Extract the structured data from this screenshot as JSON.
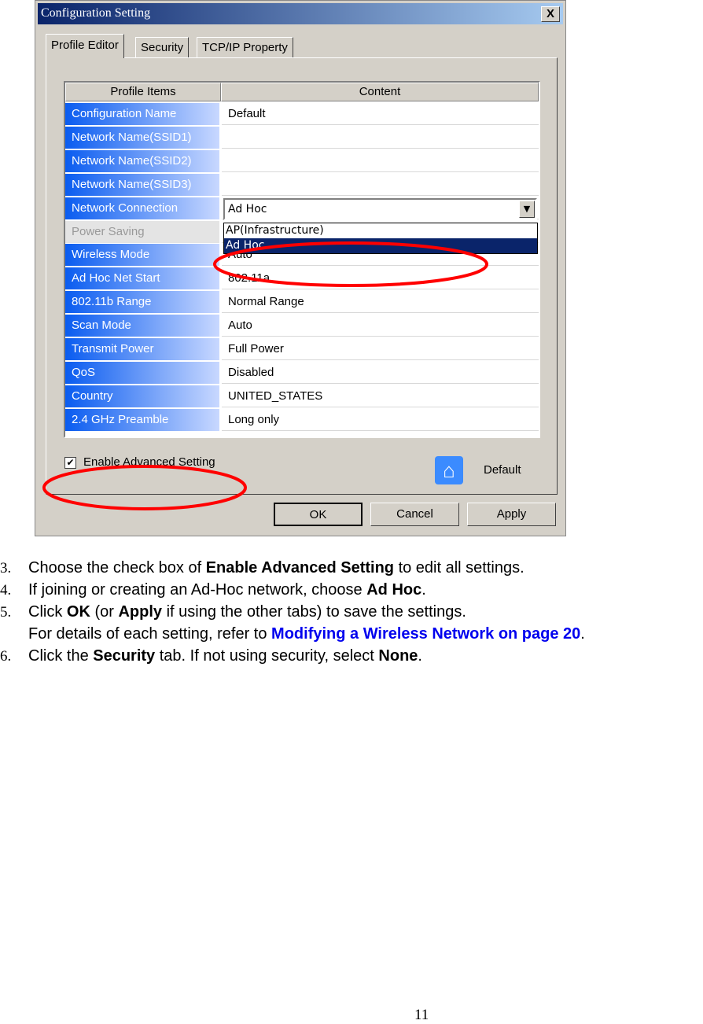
{
  "dialog": {
    "title": "Configuration Setting",
    "close": "X",
    "tabs": [
      "Profile Editor",
      "Security",
      "TCP/IP Property"
    ],
    "headers": [
      "Profile Items",
      "Content"
    ],
    "rows": [
      {
        "label": "Configuration Name",
        "value": "Default"
      },
      {
        "label": "Network Name(SSID1)",
        "value": ""
      },
      {
        "label": "Network Name(SSID2)",
        "value": ""
      },
      {
        "label": "Network Name(SSID3)",
        "value": ""
      },
      {
        "label": "Network Connection",
        "value": ""
      },
      {
        "label": "Power Saving",
        "value": "",
        "disabled": true
      },
      {
        "label": "Wireless Mode",
        "value": "Auto"
      },
      {
        "label": "Ad Hoc Net Start",
        "value": "802.11a"
      },
      {
        "label": "802.11b Range",
        "value": "Normal Range"
      },
      {
        "label": "Scan Mode",
        "value": "Auto"
      },
      {
        "label": "Transmit Power",
        "value": "Full Power"
      },
      {
        "label": "QoS",
        "value": "Disabled"
      },
      {
        "label": "Country",
        "value": "UNITED_STATES"
      },
      {
        "label": "2.4 GHz Preamble",
        "value": "Long only"
      }
    ],
    "connection_select": {
      "value": "Ad Hoc",
      "options": [
        "AP(Infrastructure)",
        "Ad Hoc"
      ],
      "selected": "Ad Hoc"
    },
    "advanced_checkbox": {
      "label": "Enable Advanced Setting",
      "checked": true
    },
    "default_label": "Default",
    "buttons": [
      "OK",
      "Cancel",
      "Apply"
    ],
    "highlight_color": "#ff0000"
  },
  "steps": [
    {
      "num": "3.",
      "parts": [
        "Choose the check box of ",
        "Enable Advanced Setting",
        " to edit all settings."
      ]
    },
    {
      "num": "4.",
      "parts": [
        "If joining or creating an Ad-Hoc network, choose ",
        "Ad Hoc",
        "."
      ]
    },
    {
      "num": "5.",
      "parts": [
        "Click ",
        "OK",
        " (or ",
        "Apply",
        " if using the other tabs) to save the settings."
      ]
    },
    {
      "num": "",
      "parts": [
        "For details of each setting, refer to ",
        "Modifying a Wireless Network on page 20",
        "."
      ]
    },
    {
      "num": "6.",
      "parts": [
        "Click the ",
        "Security",
        " tab. If not using security, select ",
        "None",
        "."
      ]
    }
  ],
  "page_number": "11"
}
